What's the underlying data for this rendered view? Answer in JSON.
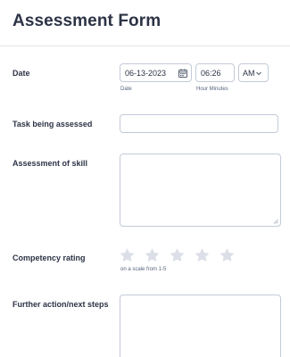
{
  "form": {
    "title": "Assessment Form"
  },
  "date_field": {
    "label": "Date",
    "date_value": "06-13-2023",
    "date_sublabel": "Date",
    "time_value": "06:26",
    "time_sublabel": "Hour Minutes",
    "ampm_value": "AM"
  },
  "task_field": {
    "label": "Task being assessed",
    "value": ""
  },
  "skill_field": {
    "label": "Assessment of skill",
    "value": ""
  },
  "rating_field": {
    "label": "Competency rating",
    "stars": 5,
    "selected": 0,
    "sublabel": "on a scale from 1-5",
    "star_color": "#dcdfe8"
  },
  "next_steps_field": {
    "label": "Further action/next steps",
    "value": ""
  }
}
